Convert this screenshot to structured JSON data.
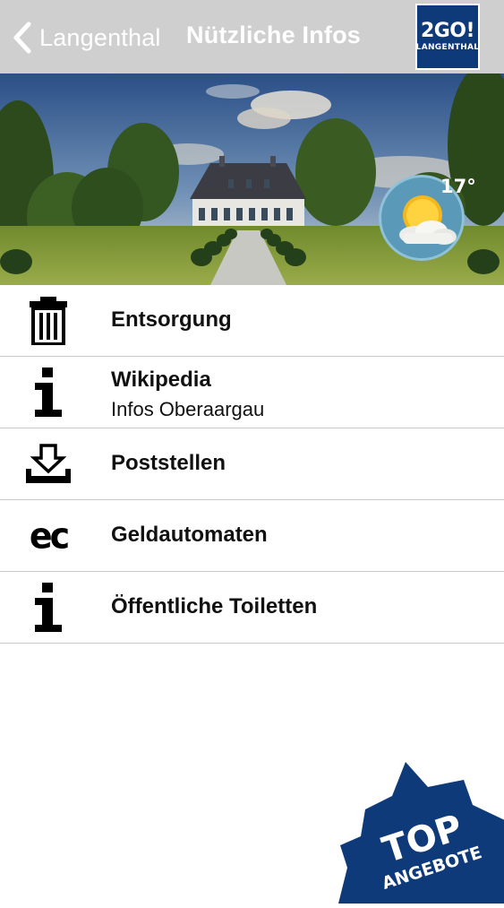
{
  "nav": {
    "back_label": "Langenthal",
    "title": "Nützliche Infos",
    "logo_main": "2GO!",
    "logo_sub": "LANGENTHAL"
  },
  "weather": {
    "temperature": "17°",
    "icon": "partly-cloudy-icon"
  },
  "items": [
    {
      "label": "Entsorgung",
      "icon": "trash-icon"
    },
    {
      "label": "Wikipedia",
      "subtitle": "Infos Oberaargau",
      "icon": "info-icon"
    },
    {
      "label": "Poststellen",
      "icon": "download-tray-icon"
    },
    {
      "label": "Geldautomaten",
      "icon": "ec-logo",
      "icon_text": "ec"
    },
    {
      "label": "Öffentliche Toiletten",
      "icon": "info-icon"
    }
  ],
  "badge": {
    "line1": "TOP",
    "line2": "ANGEBOTE",
    "color": "#0e3a7a"
  }
}
